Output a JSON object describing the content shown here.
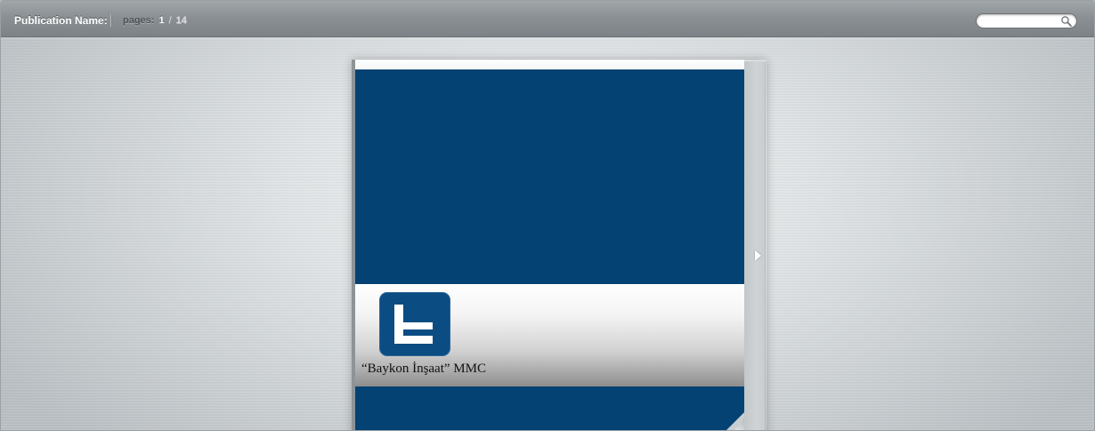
{
  "toolbar": {
    "publication_label": "Publication Name:",
    "pages_label": "pages:",
    "current_page": "1",
    "separator": "/",
    "total_pages": "14"
  },
  "search": {
    "placeholder": "",
    "value": "",
    "icon": "search-icon"
  },
  "viewer": {
    "next_icon": "next-page-arrow-icon"
  },
  "cover": {
    "company_name": "“Baykon İnşaat” MMC",
    "logo_icon": "baykon-logo-icon",
    "colors": {
      "blue": "#044273",
      "logo_blue": "#0b4c83"
    }
  }
}
